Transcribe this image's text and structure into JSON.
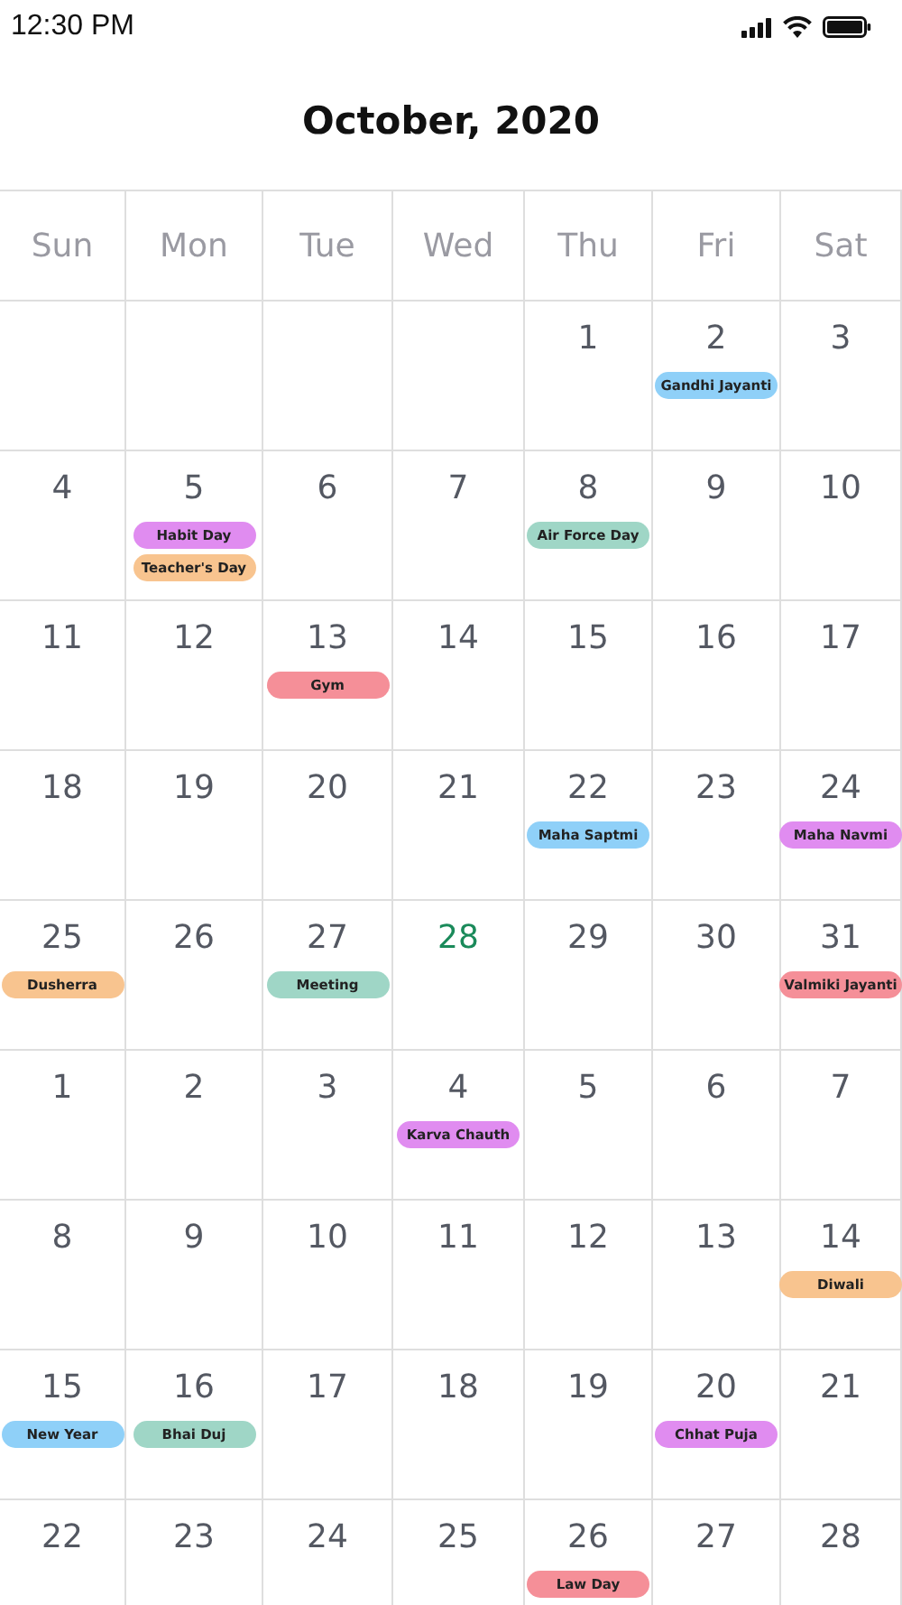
{
  "status_bar": {
    "time": "12:30 PM"
  },
  "title": "October, 2020",
  "weekdays": [
    "Sun",
    "Mon",
    "Tue",
    "Wed",
    "Thu",
    "Fri",
    "Sat"
  ],
  "weeks": [
    [
      {
        "kind": "blank"
      },
      {
        "kind": "blank"
      },
      {
        "kind": "blank"
      },
      {
        "kind": "blank"
      },
      {
        "kind": "day",
        "day": "1",
        "today": false
      },
      {
        "kind": "day",
        "day": "2",
        "today": false,
        "events": [
          {
            "label": "Gandhi Jayanti",
            "color": "#8fd0f8"
          }
        ]
      },
      {
        "kind": "day",
        "day": "3",
        "today": false
      }
    ],
    [
      {
        "kind": "day",
        "day": "4",
        "today": false
      },
      {
        "kind": "day",
        "day": "5",
        "today": false,
        "events": [
          {
            "label": "Habit Day",
            "color": "#e08cf0"
          },
          {
            "label": "Teacher's Day",
            "color": "#f8c48f"
          }
        ]
      },
      {
        "kind": "day",
        "day": "6",
        "today": false
      },
      {
        "kind": "day",
        "day": "7",
        "today": false
      },
      {
        "kind": "day",
        "day": "8",
        "today": false,
        "events": [
          {
            "label": "Air Force Day",
            "color": "#9fd6c6"
          }
        ]
      },
      {
        "kind": "day",
        "day": "9",
        "today": false
      },
      {
        "kind": "day",
        "day": "10",
        "today": false
      }
    ],
    [
      {
        "kind": "day",
        "day": "11",
        "today": false
      },
      {
        "kind": "day",
        "day": "12",
        "today": false
      },
      {
        "kind": "day",
        "day": "13",
        "today": false,
        "events": [
          {
            "label": "Gym",
            "color": "#f58f98"
          }
        ]
      },
      {
        "kind": "day",
        "day": "14",
        "today": false
      },
      {
        "kind": "day",
        "day": "15",
        "today": false
      },
      {
        "kind": "day",
        "day": "16",
        "today": false
      },
      {
        "kind": "day",
        "day": "17",
        "today": false
      }
    ],
    [
      {
        "kind": "day",
        "day": "18",
        "today": false
      },
      {
        "kind": "day",
        "day": "19",
        "today": false
      },
      {
        "kind": "day",
        "day": "20",
        "today": false
      },
      {
        "kind": "day",
        "day": "21",
        "today": false
      },
      {
        "kind": "day",
        "day": "22",
        "today": false,
        "events": [
          {
            "label": "Maha Saptmi",
            "color": "#8fd0f8"
          }
        ]
      },
      {
        "kind": "day",
        "day": "23",
        "today": false
      },
      {
        "kind": "day",
        "day": "24",
        "today": false,
        "events": [
          {
            "label": "Maha Navmi",
            "color": "#e08cf0"
          }
        ]
      }
    ],
    [
      {
        "kind": "day",
        "day": "25",
        "today": false,
        "events": [
          {
            "label": "Dusherra",
            "color": "#f8c48f"
          }
        ]
      },
      {
        "kind": "day",
        "day": "26",
        "today": false
      },
      {
        "kind": "day",
        "day": "27",
        "today": false,
        "events": [
          {
            "label": "Meeting",
            "color": "#9fd6c6"
          }
        ]
      },
      {
        "kind": "day",
        "day": "28",
        "today": true
      },
      {
        "kind": "day",
        "day": "29",
        "today": false
      },
      {
        "kind": "day",
        "day": "30",
        "today": false
      },
      {
        "kind": "day",
        "day": "31",
        "today": false,
        "events": [
          {
            "label": "Valmiki Jayanti",
            "color": "#f58f98"
          }
        ]
      }
    ],
    [
      {
        "kind": "day",
        "day": "1",
        "today": false
      },
      {
        "kind": "day",
        "day": "2",
        "today": false
      },
      {
        "kind": "day",
        "day": "3",
        "today": false
      },
      {
        "kind": "day",
        "day": "4",
        "today": false,
        "events": [
          {
            "label": "Karva Chauth",
            "color": "#e08cf0"
          }
        ]
      },
      {
        "kind": "day",
        "day": "5",
        "today": false
      },
      {
        "kind": "day",
        "day": "6",
        "today": false
      },
      {
        "kind": "day",
        "day": "7",
        "today": false
      }
    ],
    [
      {
        "kind": "day",
        "day": "8",
        "today": false
      },
      {
        "kind": "day",
        "day": "9",
        "today": false
      },
      {
        "kind": "day",
        "day": "10",
        "today": false
      },
      {
        "kind": "day",
        "day": "11",
        "today": false
      },
      {
        "kind": "day",
        "day": "12",
        "today": false
      },
      {
        "kind": "day",
        "day": "13",
        "today": false
      },
      {
        "kind": "day",
        "day": "14",
        "today": false,
        "events": [
          {
            "label": "Diwali",
            "color": "#f8c48f"
          }
        ]
      }
    ],
    [
      {
        "kind": "day",
        "day": "15",
        "today": false,
        "events": [
          {
            "label": "New Year",
            "color": "#8fd0f8"
          }
        ]
      },
      {
        "kind": "day",
        "day": "16",
        "today": false,
        "events": [
          {
            "label": "Bhai Duj",
            "color": "#9fd6c6"
          }
        ]
      },
      {
        "kind": "day",
        "day": "17",
        "today": false
      },
      {
        "kind": "day",
        "day": "18",
        "today": false
      },
      {
        "kind": "day",
        "day": "19",
        "today": false
      },
      {
        "kind": "day",
        "day": "20",
        "today": false,
        "events": [
          {
            "label": "Chhat Puja",
            "color": "#e08cf0"
          }
        ]
      },
      {
        "kind": "day",
        "day": "21",
        "today": false
      }
    ],
    [
      {
        "kind": "day",
        "day": "22",
        "today": false
      },
      {
        "kind": "day",
        "day": "23",
        "today": false
      },
      {
        "kind": "day",
        "day": "24",
        "today": false
      },
      {
        "kind": "day",
        "day": "25",
        "today": false
      },
      {
        "kind": "day",
        "day": "26",
        "today": false,
        "events": [
          {
            "label": "Law Day",
            "color": "#f58f98"
          }
        ]
      },
      {
        "kind": "day",
        "day": "27",
        "today": false
      },
      {
        "kind": "day",
        "day": "28",
        "today": false
      }
    ]
  ]
}
